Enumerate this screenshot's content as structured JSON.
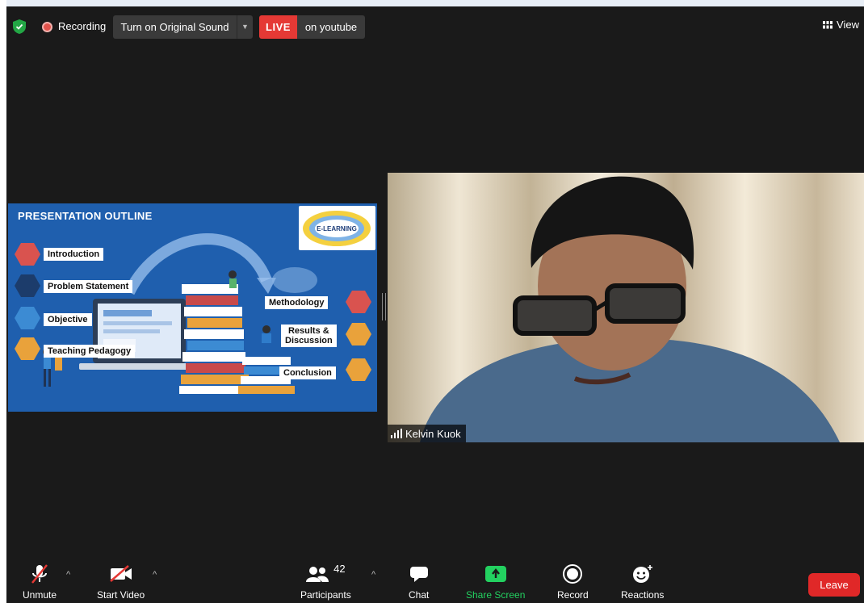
{
  "topbar": {
    "recording_label": "Recording",
    "original_sound_label": "Turn on Original Sound",
    "live_badge": "LIVE",
    "live_target": "on youtube",
    "view_label": "View"
  },
  "slide": {
    "title": "PRESENTATION OUTLINE",
    "logo_text": "E-LEARNING",
    "items_left": [
      "Introduction",
      "Problem Statement",
      "Objective",
      "Teaching Pedagogy"
    ],
    "items_right": [
      "Methodology",
      "Results &",
      "Discussion",
      "Conclusion"
    ]
  },
  "speaker": {
    "name": "Kelvin Kuok"
  },
  "toolbar": {
    "unmute": "Unmute",
    "start_video": "Start Video",
    "participants": "Participants",
    "participants_count": "42",
    "chat": "Chat",
    "share_screen": "Share Screen",
    "record": "Record",
    "reactions": "Reactions",
    "leave": "Leave"
  },
  "colors": {
    "window_bg": "#1a1a1a",
    "live_red": "#e53935",
    "share_green": "#23d160",
    "leave_red": "#e02828",
    "slide_blue": "#1f5fae"
  },
  "icons": [
    "shield-icon",
    "record-dot-icon",
    "dropdown-caret-icon",
    "grid-view-icon",
    "signal-icon",
    "mic-muted-icon",
    "video-off-icon",
    "participants-icon",
    "chat-icon",
    "share-screen-icon",
    "record-icon",
    "reactions-icon"
  ]
}
